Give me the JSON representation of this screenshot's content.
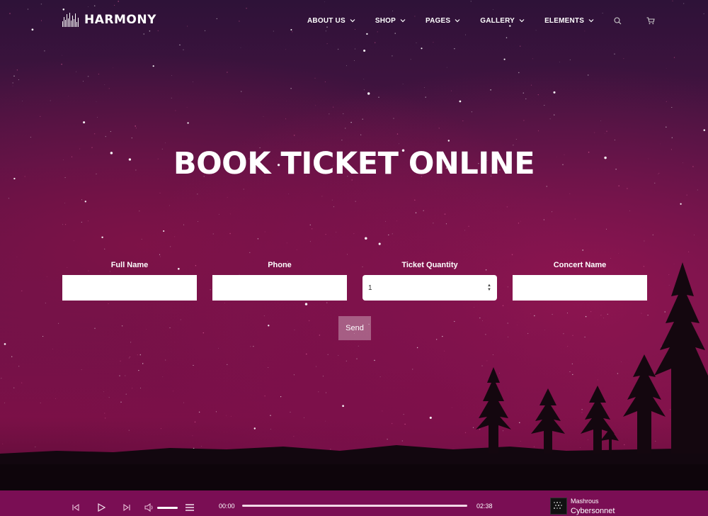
{
  "brand": {
    "name": "HARMONY"
  },
  "nav": {
    "items": [
      {
        "label": "ABOUT US"
      },
      {
        "label": "SHOP"
      },
      {
        "label": "PAGES"
      },
      {
        "label": "GALLERY"
      },
      {
        "label": "ELEMENTS"
      }
    ],
    "icons": [
      "search-icon",
      "cart-icon"
    ]
  },
  "hero": {
    "title": "BOOK TICKET ONLINE"
  },
  "form": {
    "full_name": {
      "label": "Full Name",
      "value": ""
    },
    "phone": {
      "label": "Phone",
      "value": ""
    },
    "ticket_quantity": {
      "label": "Ticket Quantity",
      "value": "1"
    },
    "concert_name": {
      "label": "Concert Name",
      "value": ""
    },
    "send_label": "Send"
  },
  "player": {
    "current_time": "00:00",
    "duration": "02:38",
    "progress": 0,
    "volume": 1,
    "artist": "Mashrous",
    "track": "Cybersonnet"
  },
  "colors": {
    "accent": "#7a0e54",
    "sky_top": "#2e1238",
    "sky_bottom": "#7b1047"
  }
}
